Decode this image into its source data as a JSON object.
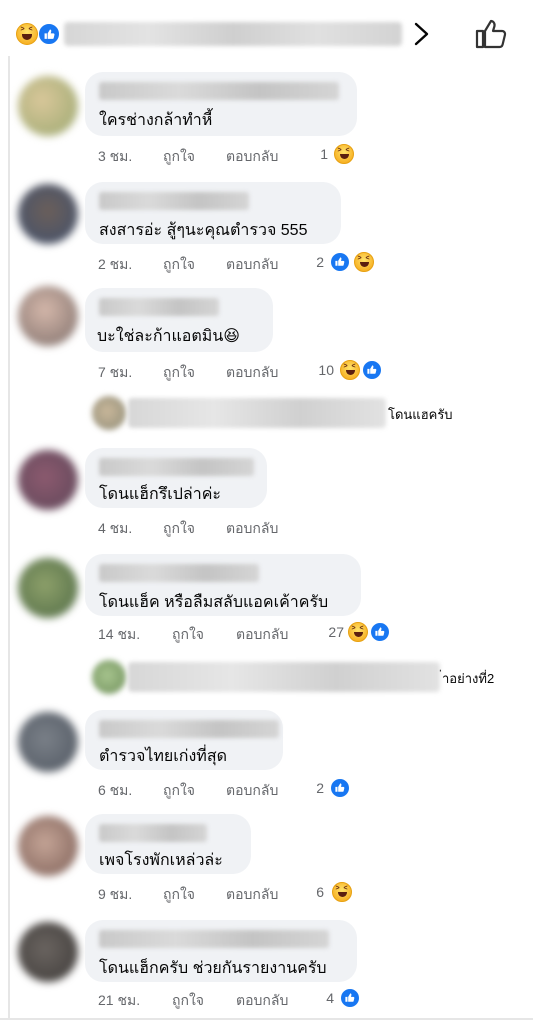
{
  "header": {
    "reactions": [
      "haha-icon",
      "like-icon"
    ],
    "chevron_icon": "chevron-right-icon",
    "like_action_icon": "thumbs-up-icon"
  },
  "actions": {
    "like": "ถูกใจ",
    "reply": "ตอบกลับ"
  },
  "comments": [
    {
      "text": "ใครช่างกล้าทำหี้",
      "time": "3 ชม.",
      "count": "1",
      "reactions": [
        "haha"
      ]
    },
    {
      "text": "สงสารอ่ะ สู้ๆนะคุณตำรวจ 555",
      "time": "2 ชม.",
      "count": "2",
      "reactions": [
        "like",
        "haha"
      ]
    },
    {
      "text": "บะใช่ละก้าแอตมิน😆",
      "time": "7 ชม.",
      "count": "10",
      "reactions": [
        "haha",
        "like"
      ]
    },
    {
      "text": "โดนแฮ็กรึเปล่าค่ะ",
      "time": "4 ชม."
    },
    {
      "text": "โดนแฮ็ค หรือลืมสลับแอคเค้าครับ",
      "time": "14 ชม.",
      "count": "27",
      "reactions": [
        "haha",
        "like"
      ]
    },
    {
      "text": "ตำรวจไทยเก่งที่สุด",
      "time": "6 ชม.",
      "count": "2",
      "reactions": [
        "like"
      ]
    },
    {
      "text": "เพจโรงพักเหล่วล่ะ",
      "time": "9 ชม.",
      "count": "6",
      "reactions": [
        "haha"
      ]
    },
    {
      "text": "โดนแฮ็กครับ ช่วยกันรายงานครับ",
      "time": "21 ชม.",
      "count": "4",
      "reactions": [
        "like"
      ]
    }
  ],
  "replies": [
    {
      "text": "โดนแฮครับ"
    },
    {
      "text": "่าอย่างที่2"
    }
  ],
  "colors": {
    "bubble": "#f0f2f5",
    "meta_text": "#65676b",
    "like_blue": "#1877f2",
    "haha_yellow": "#f7b125"
  }
}
